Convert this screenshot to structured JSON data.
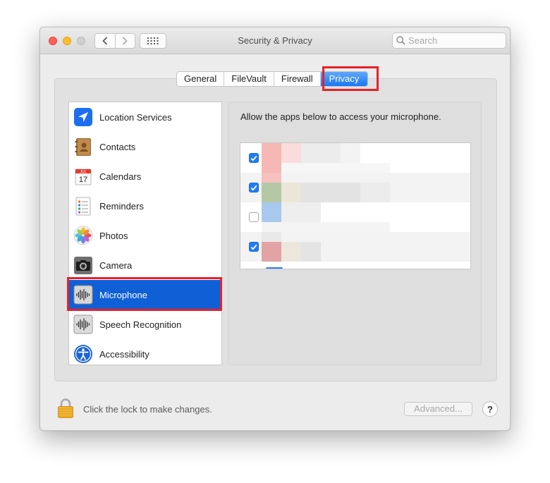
{
  "window": {
    "title": "Security & Privacy",
    "search_placeholder": "Search"
  },
  "tabs": [
    {
      "label": "General",
      "active": false
    },
    {
      "label": "FileVault",
      "active": false
    },
    {
      "label": "Firewall",
      "active": false
    },
    {
      "label": "Privacy",
      "active": true
    }
  ],
  "sidebar": {
    "selected": "Microphone",
    "items": [
      {
        "label": "Location Services",
        "icon": "location-arrow-icon"
      },
      {
        "label": "Contacts",
        "icon": "contacts-book-icon"
      },
      {
        "label": "Calendars",
        "icon": "calendar-icon",
        "calendar_month": "JUL",
        "calendar_day": "17"
      },
      {
        "label": "Reminders",
        "icon": "reminders-list-icon"
      },
      {
        "label": "Photos",
        "icon": "photos-flower-icon"
      },
      {
        "label": "Camera",
        "icon": "camera-icon"
      },
      {
        "label": "Microphone",
        "icon": "microphone-waveform-icon"
      },
      {
        "label": "Speech Recognition",
        "icon": "speech-waveform-icon"
      },
      {
        "label": "Accessibility",
        "icon": "accessibility-person-icon"
      }
    ]
  },
  "content": {
    "description": "Allow the apps below to access your microphone.",
    "apps": [
      {
        "checked": true
      },
      {
        "checked": true
      },
      {
        "checked": false
      },
      {
        "checked": true
      }
    ]
  },
  "footer": {
    "lock_text": "Click the lock to make changes.",
    "advanced_label": "Advanced...",
    "help_label": "?"
  },
  "colors": {
    "accent": "#1a76f5",
    "selection": "#0f60d6",
    "highlight_box": "#e8202a"
  }
}
